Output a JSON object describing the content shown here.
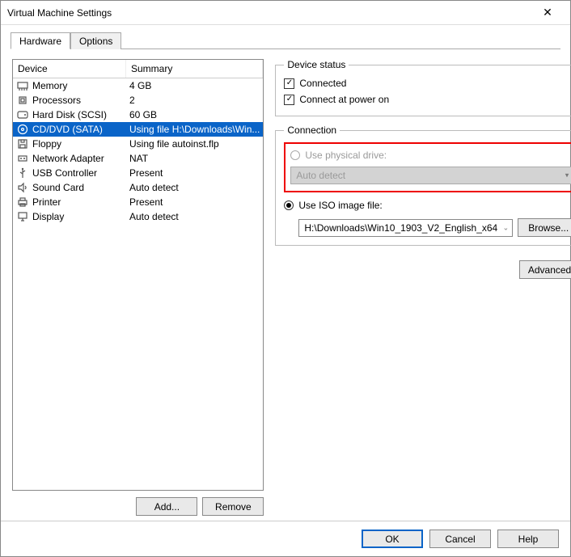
{
  "window": {
    "title": "Virtual Machine Settings"
  },
  "tabs": {
    "hardware": "Hardware",
    "options": "Options",
    "active": "hardware"
  },
  "list": {
    "header_device": "Device",
    "header_summary": "Summary",
    "items": [
      {
        "icon": "memory-icon",
        "device": "Memory",
        "summary": "4 GB",
        "selected": false
      },
      {
        "icon": "cpu-icon",
        "device": "Processors",
        "summary": "2",
        "selected": false
      },
      {
        "icon": "disk-icon",
        "device": "Hard Disk (SCSI)",
        "summary": "60 GB",
        "selected": false
      },
      {
        "icon": "cd-icon",
        "device": "CD/DVD (SATA)",
        "summary": "Using file H:\\Downloads\\Win...",
        "selected": true
      },
      {
        "icon": "floppy-icon",
        "device": "Floppy",
        "summary": "Using file autoinst.flp",
        "selected": false
      },
      {
        "icon": "network-icon",
        "device": "Network Adapter",
        "summary": "NAT",
        "selected": false
      },
      {
        "icon": "usb-icon",
        "device": "USB Controller",
        "summary": "Present",
        "selected": false
      },
      {
        "icon": "sound-icon",
        "device": "Sound Card",
        "summary": "Auto detect",
        "selected": false
      },
      {
        "icon": "printer-icon",
        "device": "Printer",
        "summary": "Present",
        "selected": false
      },
      {
        "icon": "display-icon",
        "device": "Display",
        "summary": "Auto detect",
        "selected": false
      }
    ]
  },
  "left_buttons": {
    "add": "Add...",
    "remove": "Remove"
  },
  "device_status": {
    "legend": "Device status",
    "connected": {
      "label": "Connected",
      "checked": true
    },
    "connect_power_on": {
      "label": "Connect at power on",
      "checked": true
    }
  },
  "connection": {
    "legend": "Connection",
    "physical": {
      "label": "Use physical drive:",
      "enabled": false,
      "value": "Auto detect"
    },
    "iso": {
      "label": "Use ISO image file:",
      "selected": true,
      "value": "H:\\Downloads\\Win10_1903_V2_English_x64",
      "browse": "Browse..."
    },
    "advanced": "Advanced..."
  },
  "footer": {
    "ok": "OK",
    "cancel": "Cancel",
    "help": "Help"
  }
}
